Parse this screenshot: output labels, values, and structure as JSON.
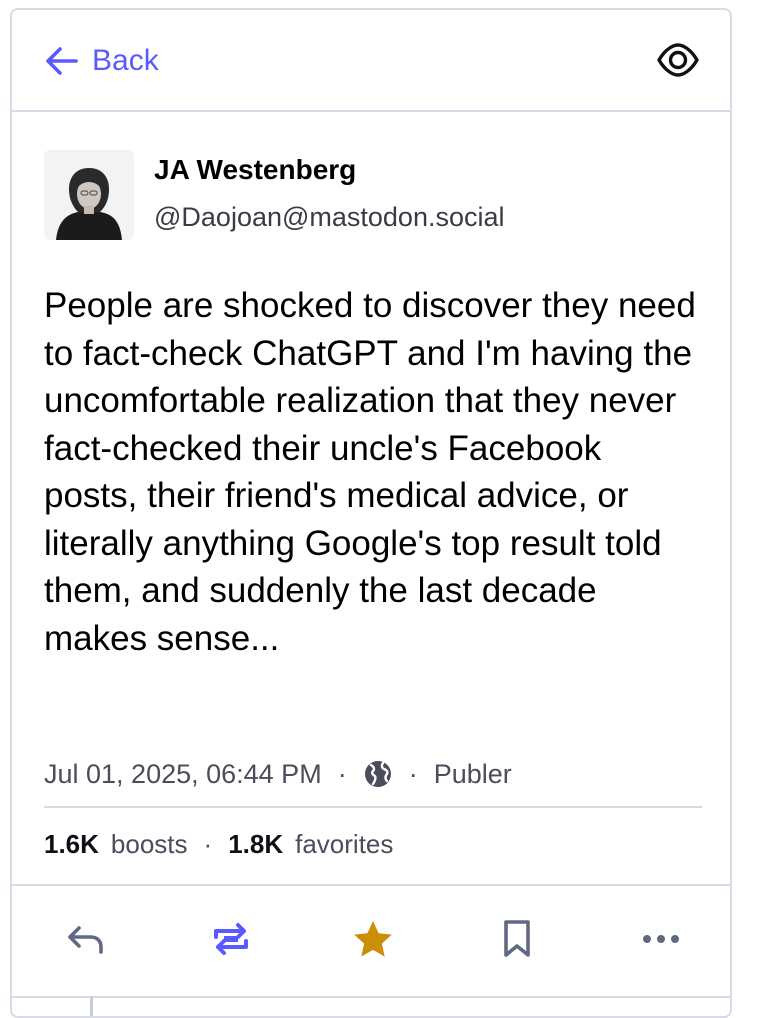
{
  "header": {
    "back_label": "Back",
    "back_icon": "arrow-left-icon",
    "visibility_icon": "eye-icon"
  },
  "post": {
    "author": {
      "display_name": "JA Westenberg",
      "handle": "@Daojoan@mastodon.social",
      "avatar_icon": "avatar"
    },
    "content": "People are shocked to discover they need to fact-check ChatGPT and I'm having the uncomfortable realization that they never fact-checked their uncle's Facebook posts, their friend's medical advice, or literally anything Google's top result told them, and suddenly the last decade makes sense...",
    "timestamp": "Jul 01, 2025, 06:44 PM",
    "separator": "·",
    "visibility_icon": "globe-icon",
    "application": "Publer",
    "stats": {
      "boosts_count": "1.6K",
      "boosts_label": "boosts",
      "favorites_count": "1.8K",
      "favorites_label": "favorites"
    }
  },
  "actions": [
    {
      "name": "reply",
      "icon": "reply-icon"
    },
    {
      "name": "boost",
      "icon": "boost-icon"
    },
    {
      "name": "favorite",
      "icon": "star-icon"
    },
    {
      "name": "bookmark",
      "icon": "bookmark-icon"
    },
    {
      "name": "more",
      "icon": "ellipsis-icon"
    }
  ],
  "colors": {
    "accent": "#595aff",
    "favorite": "#ca8f04",
    "muted": "#606984",
    "border": "#d9dae8"
  }
}
